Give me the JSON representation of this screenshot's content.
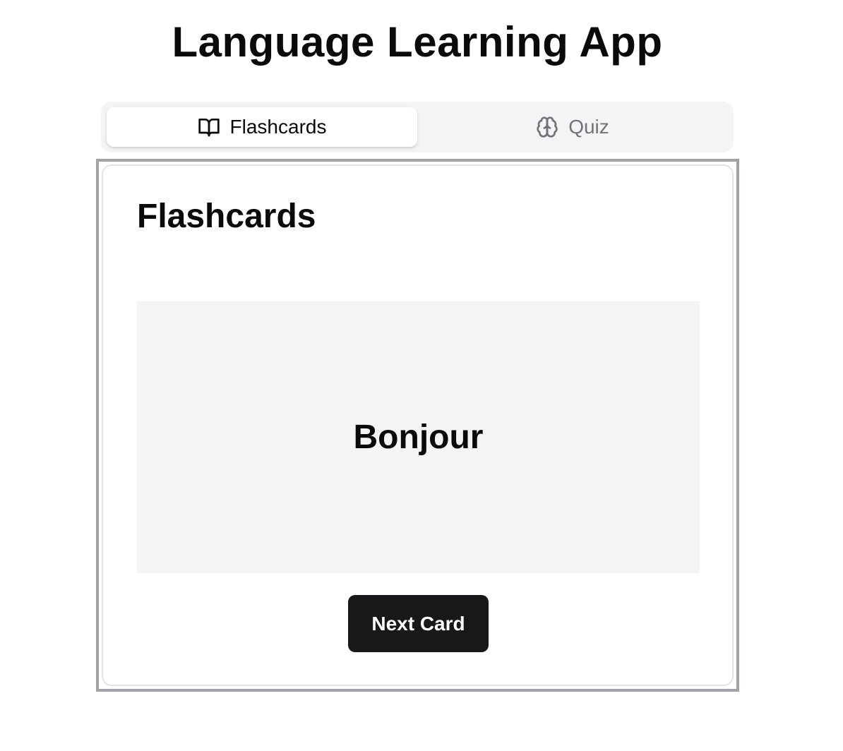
{
  "app": {
    "title": "Language Learning App"
  },
  "tabs": [
    {
      "label": "Flashcards",
      "icon": "book-open-icon",
      "active": true
    },
    {
      "label": "Quiz",
      "icon": "brain-icon",
      "active": false
    }
  ],
  "panel": {
    "title": "Flashcards",
    "card_word": "Bonjour",
    "next_button_label": "Next Card"
  },
  "colors": {
    "primary_button": "#18181b",
    "tab_bar_bg": "#f4f4f5",
    "card_face_bg": "#f4f4f4",
    "inactive_tab_text": "#71717a"
  }
}
